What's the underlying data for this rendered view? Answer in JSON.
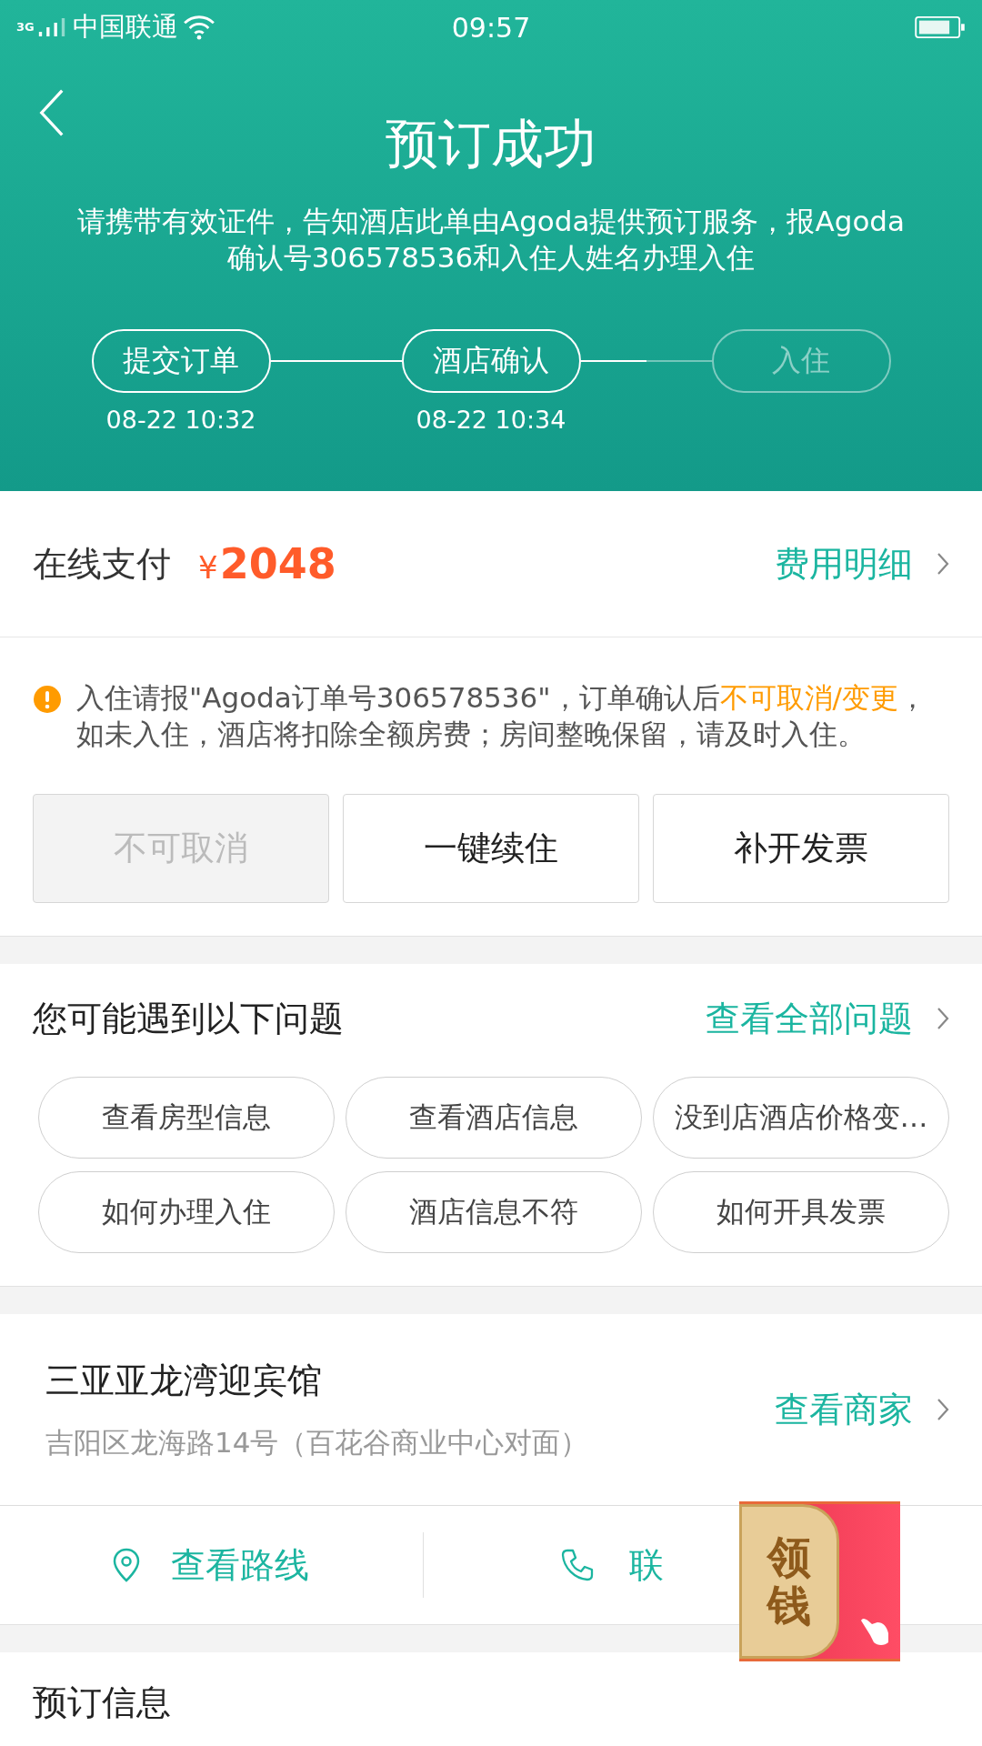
{
  "status_bar": {
    "network": "3G",
    "carrier": "中国联通",
    "time": "09:57"
  },
  "header": {
    "title": "预订成功",
    "message": "请携带有效证件，告知酒店此单由Agoda提供预订服务，报Agoda确认号306578536和入住人姓名办理入住",
    "steps": [
      {
        "label": "提交订单",
        "time": "08-22 10:32",
        "done": true
      },
      {
        "label": "酒店确认",
        "time": "08-22 10:34",
        "done": true
      },
      {
        "label": "入住",
        "done": false
      }
    ]
  },
  "payment": {
    "label": "在线支付",
    "currency": "¥",
    "amount": "2048",
    "link": "费用明细"
  },
  "notice": {
    "parts": [
      {
        "text": "入住请报\"Agoda订单号306578536\"，订单确认后",
        "highlight": false
      },
      {
        "text": "不可取消/变更",
        "highlight": true
      },
      {
        "text": "，如未入住，酒店将扣除全额房费；房间整晚保留，请及时入住。",
        "highlight": false
      }
    ]
  },
  "actions": [
    {
      "label": "不可取消",
      "disabled": true
    },
    {
      "label": "一键续住",
      "disabled": false
    },
    {
      "label": "补开发票",
      "disabled": false
    }
  ],
  "faq": {
    "title": "您可能遇到以下问题",
    "link": "查看全部问题",
    "chips": [
      "查看房型信息",
      "查看酒店信息",
      "没到店酒店价格变…",
      "如何办理入住",
      "酒店信息不符",
      "如何开具发票"
    ]
  },
  "hotel": {
    "name": "三亚亚龙湾迎宾馆",
    "address": "吉阳区龙海路14号（百花谷商业中心对面）",
    "link": "查看商家"
  },
  "contact": [
    {
      "kind": "route",
      "label": "查看路线"
    },
    {
      "kind": "phone",
      "label": "联"
    }
  ],
  "promo_badge": {
    "label": "领钱"
  },
  "next_section": {
    "title": "预订信息"
  }
}
